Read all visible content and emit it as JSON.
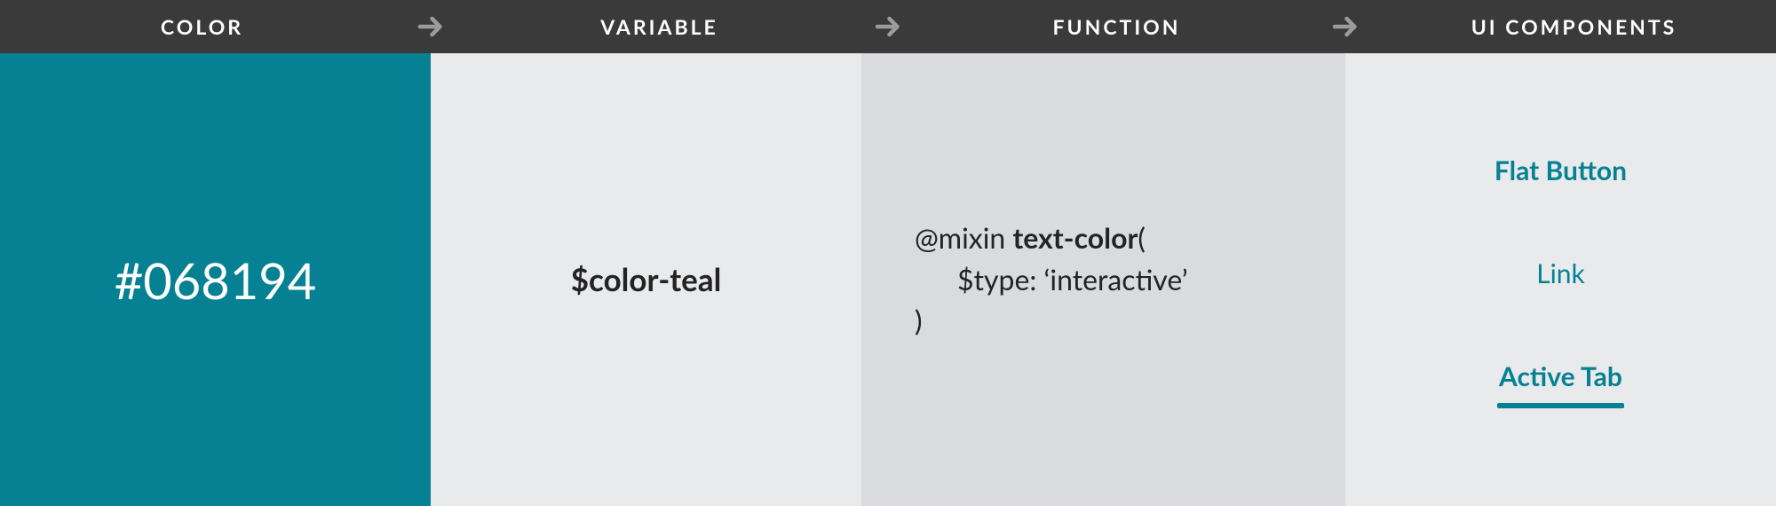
{
  "header": {
    "col1": "COLOR",
    "col2": "VARIABLE",
    "col3": "FUNCTION",
    "col4": "UI COMPONENTS"
  },
  "color": {
    "hex": "#068194"
  },
  "variable": {
    "name": "$color-teal"
  },
  "function": {
    "prefix": "@mixin ",
    "name": "text-color",
    "open": "(",
    "arg": "$type: ‘interactive’",
    "close": ")"
  },
  "ui": {
    "flat_button": "Flat Button",
    "link": "Link",
    "active_tab": "Active Tab"
  }
}
